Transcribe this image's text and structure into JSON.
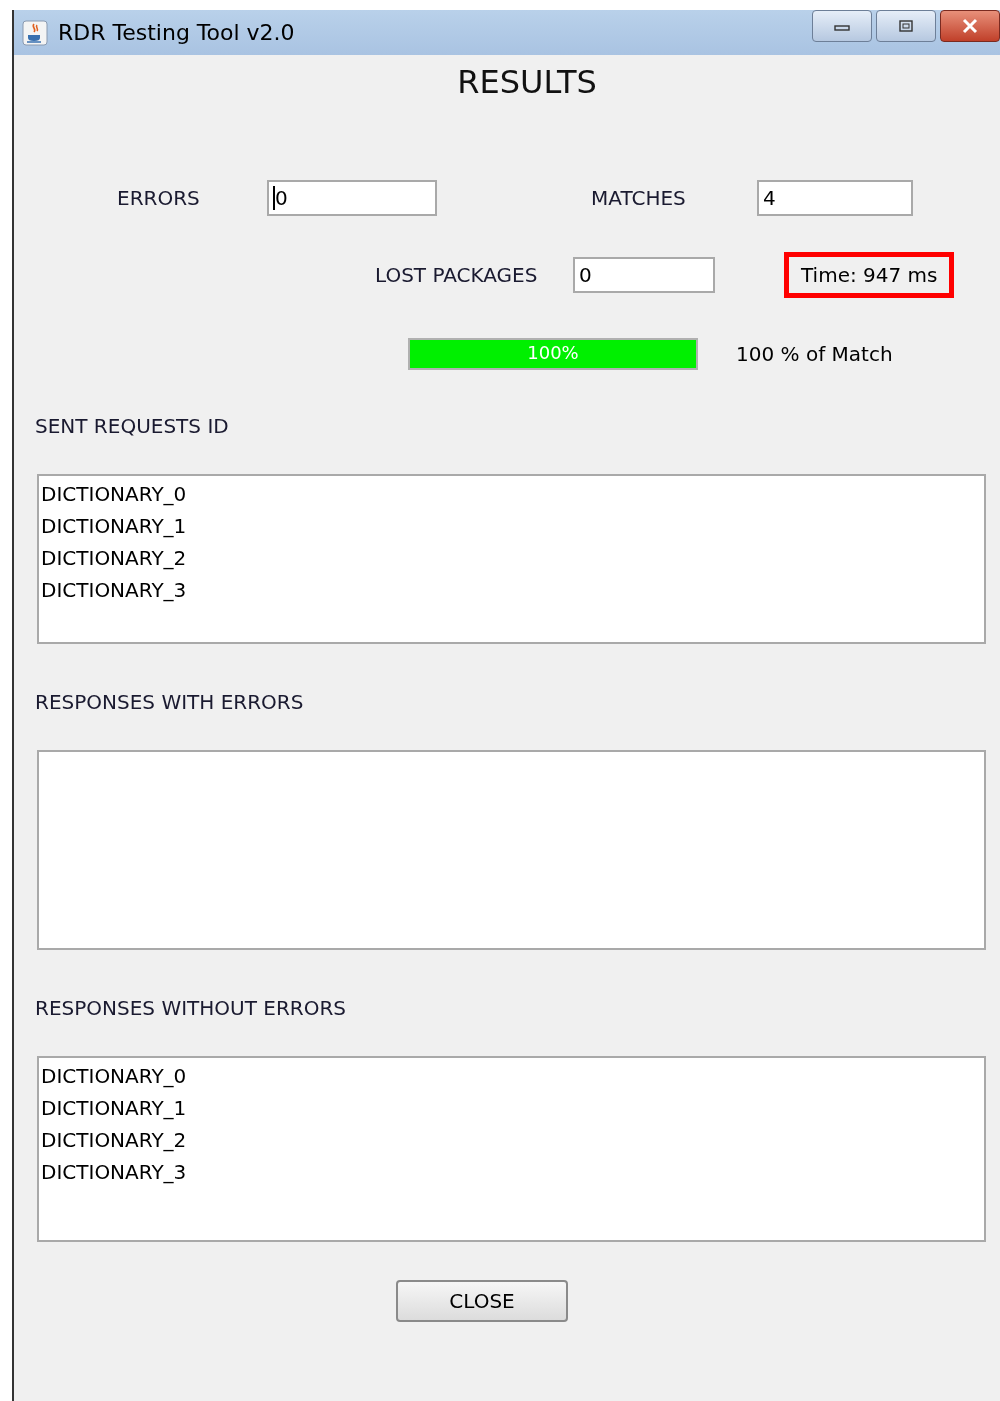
{
  "window": {
    "title": "RDR Testing Tool v2.0"
  },
  "heading": "RESULTS",
  "errors": {
    "label": "ERRORS",
    "value": "0",
    "focused": true
  },
  "matches": {
    "label": "MATCHES",
    "value": "4"
  },
  "lost_packages": {
    "label": "LOST PACKAGES",
    "value": "0"
  },
  "time": {
    "text": "Time: 947 ms",
    "highlighted": true
  },
  "progress": {
    "level": 1,
    "text": "100%",
    "caption": "100 % of Match"
  },
  "sections": [
    {
      "label": "SENT REQUESTS ID",
      "items": [
        "DICTIONARY_0",
        "DICTIONARY_1",
        "DICTIONARY_2",
        "DICTIONARY_3"
      ]
    },
    {
      "label": "RESPONSES WITH ERRORS"
    },
    {
      "label": "RESPONSES WITHOUT ERRORS",
      "items": [
        "DICTIONARY_0",
        "DICTIONARY_1",
        "DICTIONARY_2",
        "DICTIONARY_3"
      ]
    }
  ],
  "close_button": "CLOSE"
}
